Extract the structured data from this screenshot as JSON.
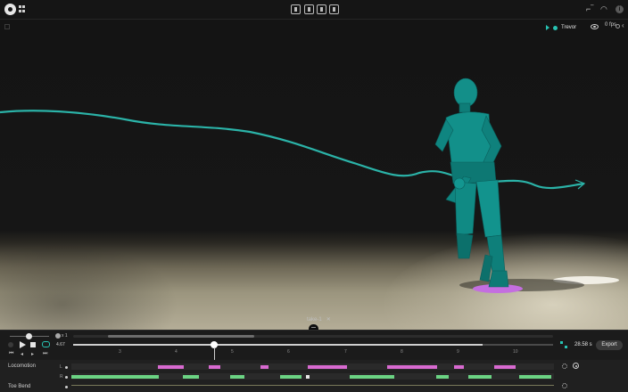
{
  "toolbar": {
    "logo_icon": "app-logo-icon",
    "apps_icon": "grid-icon",
    "tools": [
      "capture-icon",
      "retarget-icon",
      "headset-icon",
      "save-icon"
    ],
    "right_icons": [
      "graph-icon",
      "wifi-icon",
      "info-icon"
    ]
  },
  "viewport": {
    "character_name": "Trevor",
    "character_color": "#27c2b2",
    "frame_count": "0 fps"
  },
  "take": {
    "name": "take-1",
    "close": "✕"
  },
  "playback": {
    "speed": "x 1",
    "time": "4.67",
    "progress_fraction": 0.294,
    "duration": "28.58 s",
    "export_label": "Export",
    "ticks": [
      "3",
      "4",
      "5",
      "6",
      "7",
      "8",
      "9",
      "10"
    ]
  },
  "tracks": [
    {
      "name": "Locomotion",
      "side": "L"
    },
    {
      "name": "",
      "side": "R"
    },
    {
      "name": "Toe Bend",
      "side": ""
    }
  ],
  "colors": {
    "accent": "#27c2b2",
    "left_foot": "#d86ad0",
    "right_foot": "#6bd383"
  }
}
